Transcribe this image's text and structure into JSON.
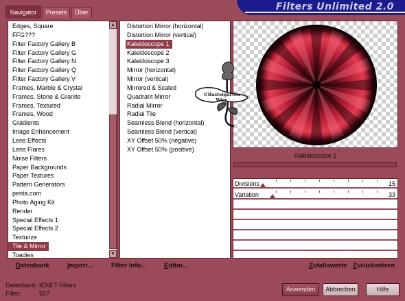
{
  "tabs": [
    "Navigator",
    "Presets",
    "Über"
  ],
  "banner": {
    "title": "Filters Unlimited 2.0"
  },
  "categories": [
    "Edges, Square",
    "FFG???",
    "Filter Factory Gallery B",
    "Filter Factory Gallery G",
    "Filter Factory Gallery N",
    "Filter Factory Gallery Q",
    "Filter Factory Gallery V",
    "Frames, Marble & Crystal",
    "Frames, Stone & Granite",
    "Frames, Textured",
    "Frames, Wood",
    "Gradients",
    "Image Enhancement",
    "Lens Effects",
    "Lens Flares",
    "Noise Filters",
    "Paper Backgrounds",
    "Paper Textures",
    "Pattern Generators",
    "penta.com",
    "Photo Aging Kit",
    "Render",
    "Special Effects 1",
    "Special Effects 2",
    "Texturize",
    "Tile & Mirror",
    "Toadies"
  ],
  "selected_category": "Tile & Mirror",
  "filters": [
    "Distortion Mirror (horizontal)",
    "Distortion Mirror (vertical)",
    "Kaleidoscope 1",
    "Kaleidoscope 2",
    "Kaleidoscope 3",
    "Mirror (horizontal)",
    "Mirror (vertical)",
    "Mirrored & Scaled",
    "Quadrant Mirror",
    "Radial Mirror",
    "Radial Tile",
    "Seamless Blend (horizontal)",
    "Seamless Blend (vertical)",
    "XY Offset 50% (negative)",
    "XY Offset 50% (positive)"
  ],
  "selected_filter": "Kaleidoscope 1",
  "preview": {
    "label": "Kaleidoscope 1",
    "watermark": "©Bastelgarten Wien"
  },
  "params": [
    {
      "label": "Divisions",
      "value": "15",
      "level": 0.059
    },
    {
      "label": "Variation",
      "value": "33",
      "level": 0.129
    }
  ],
  "toolbar": {
    "database_u": "D",
    "database_rest": "atenbank",
    "import_u": "I",
    "import_rest": "mport...",
    "filterinfo_u": "Filter I",
    "filterinfo_rest": "nfo...",
    "editor_u": "E",
    "editor_rest": "ditor...",
    "randomize_u": "Z",
    "randomize_rest": "ufallswerte",
    "reset_u": "Z",
    "reset_rest": "urücksetzen"
  },
  "info": {
    "database_label": "Datenbank:",
    "database_value": "ICNET-Filters",
    "filter_label": "Filter:",
    "filter_value": "927"
  },
  "buttons": {
    "apply": "Anwenden",
    "cancel": "Abbrechen",
    "help": "Hilfe"
  },
  "colors": {
    "frame": "#9a4a58",
    "selection": "#8e3a47",
    "banner": "#1d1a8c"
  }
}
